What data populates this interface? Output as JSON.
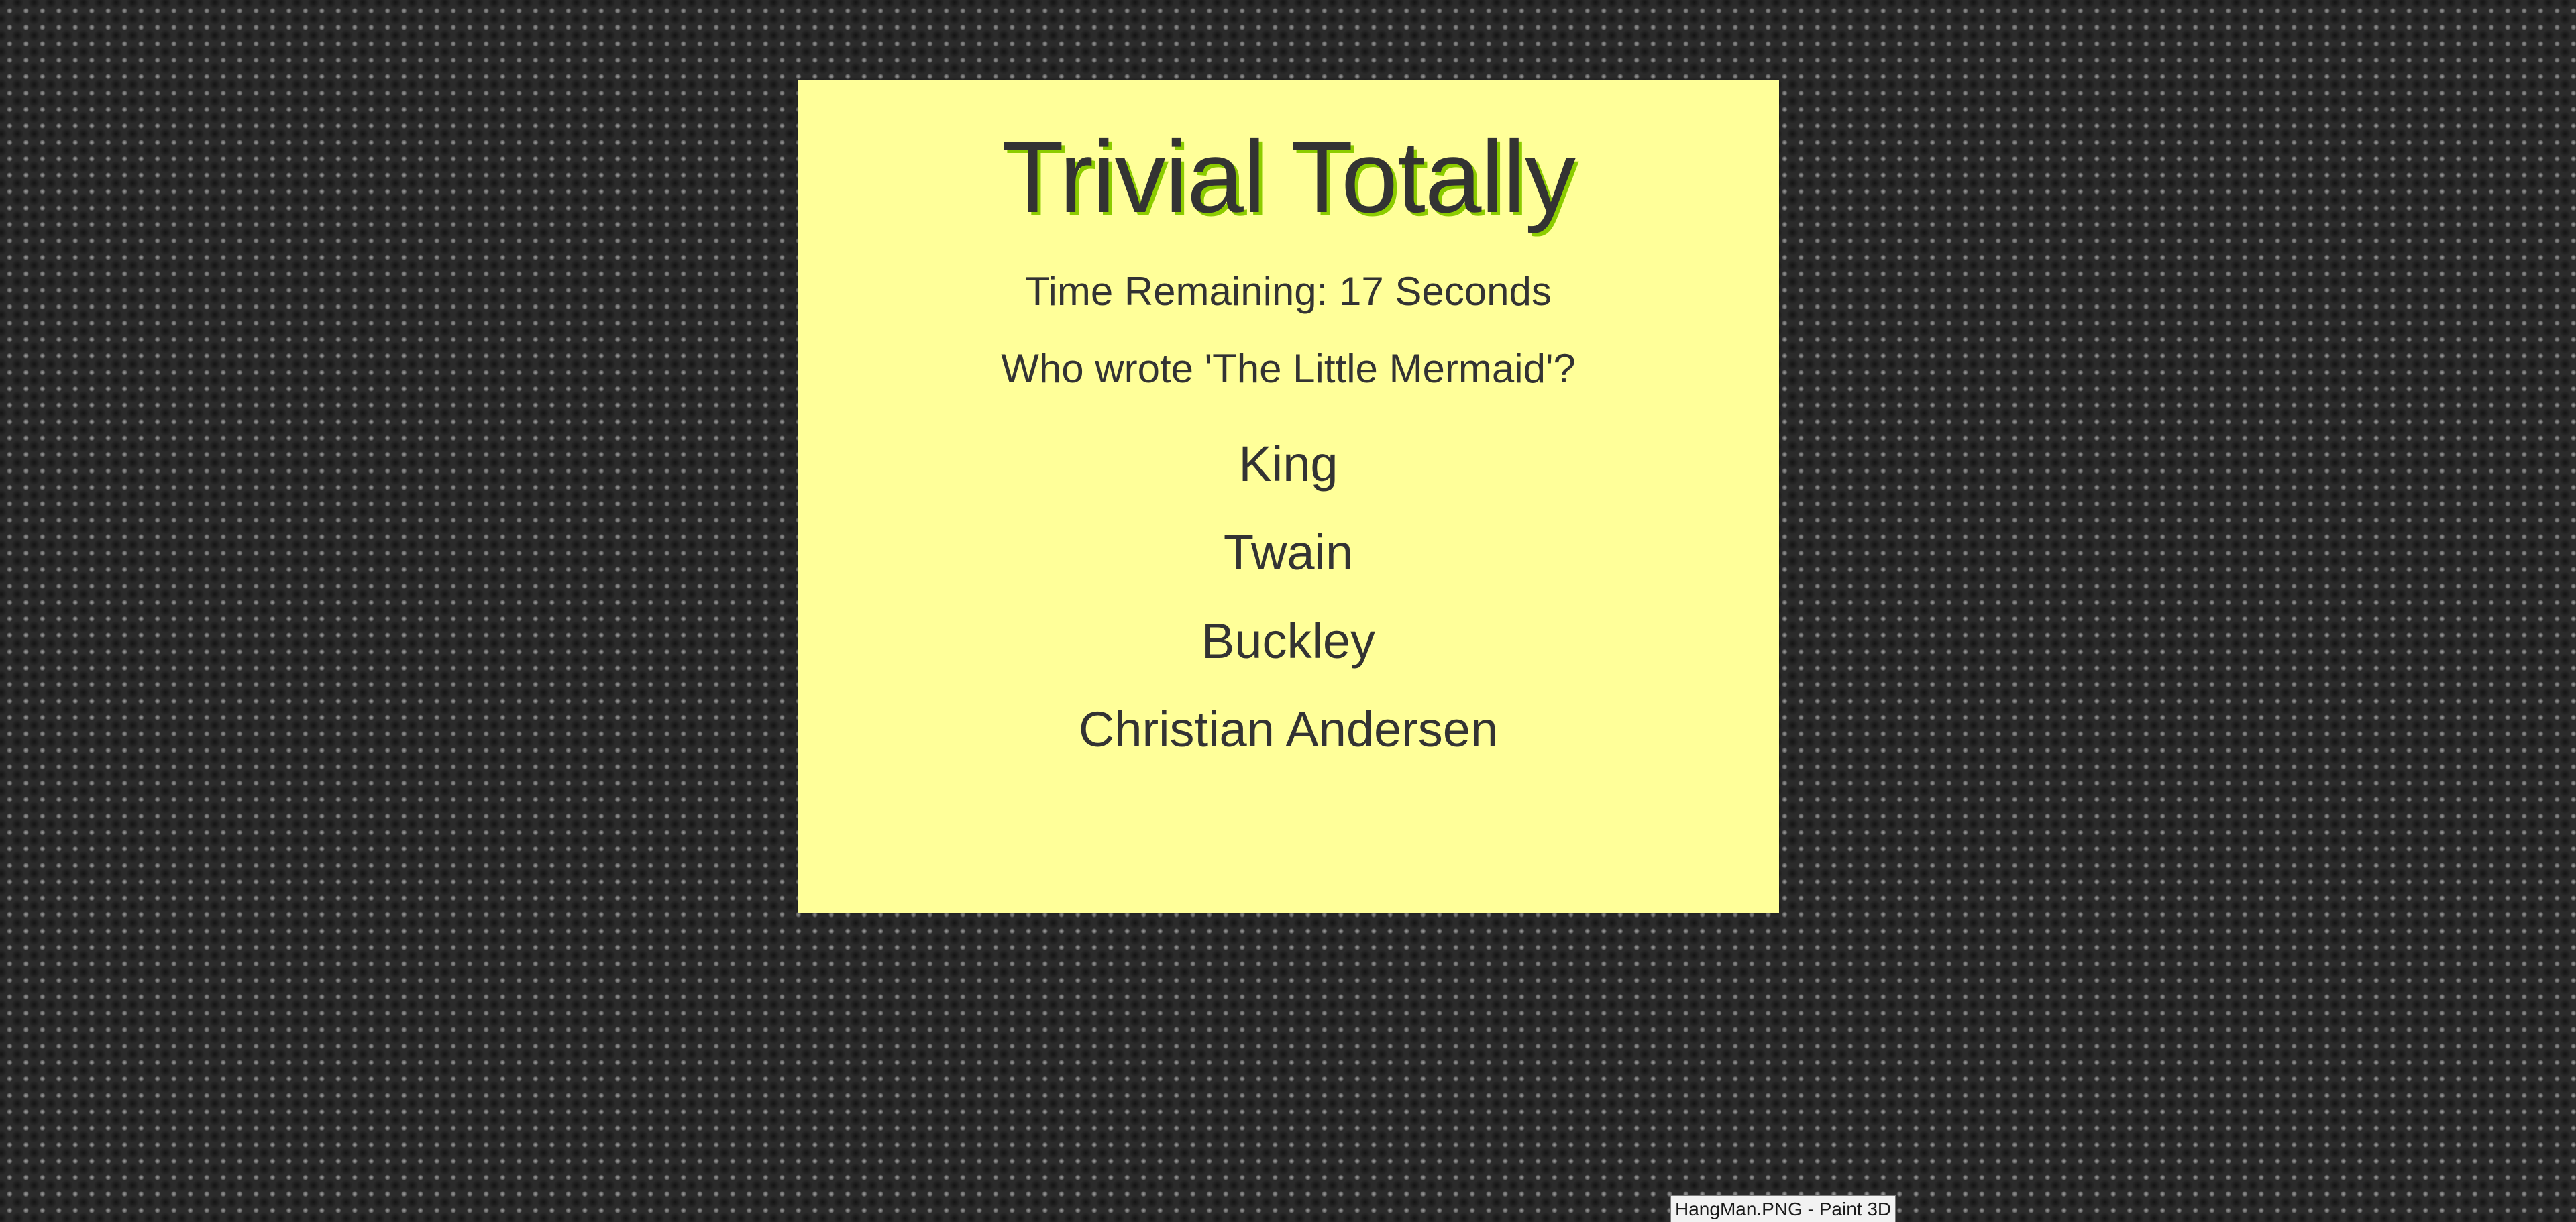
{
  "game": {
    "title": "Trivial Totally",
    "timer_text": "Time Remaining: 17 Seconds",
    "question": "Who wrote 'The Little Mermaid'?",
    "answers": [
      "King",
      "Twain",
      "Buckley",
      "Christian Andersen"
    ]
  },
  "tooltip": {
    "text": "HangMan.PNG - Paint 3D"
  },
  "colors": {
    "card_background": "#ffff99",
    "text": "#333333",
    "title_shadow": "#8ccc00",
    "page_background": "#2b2b2b"
  }
}
